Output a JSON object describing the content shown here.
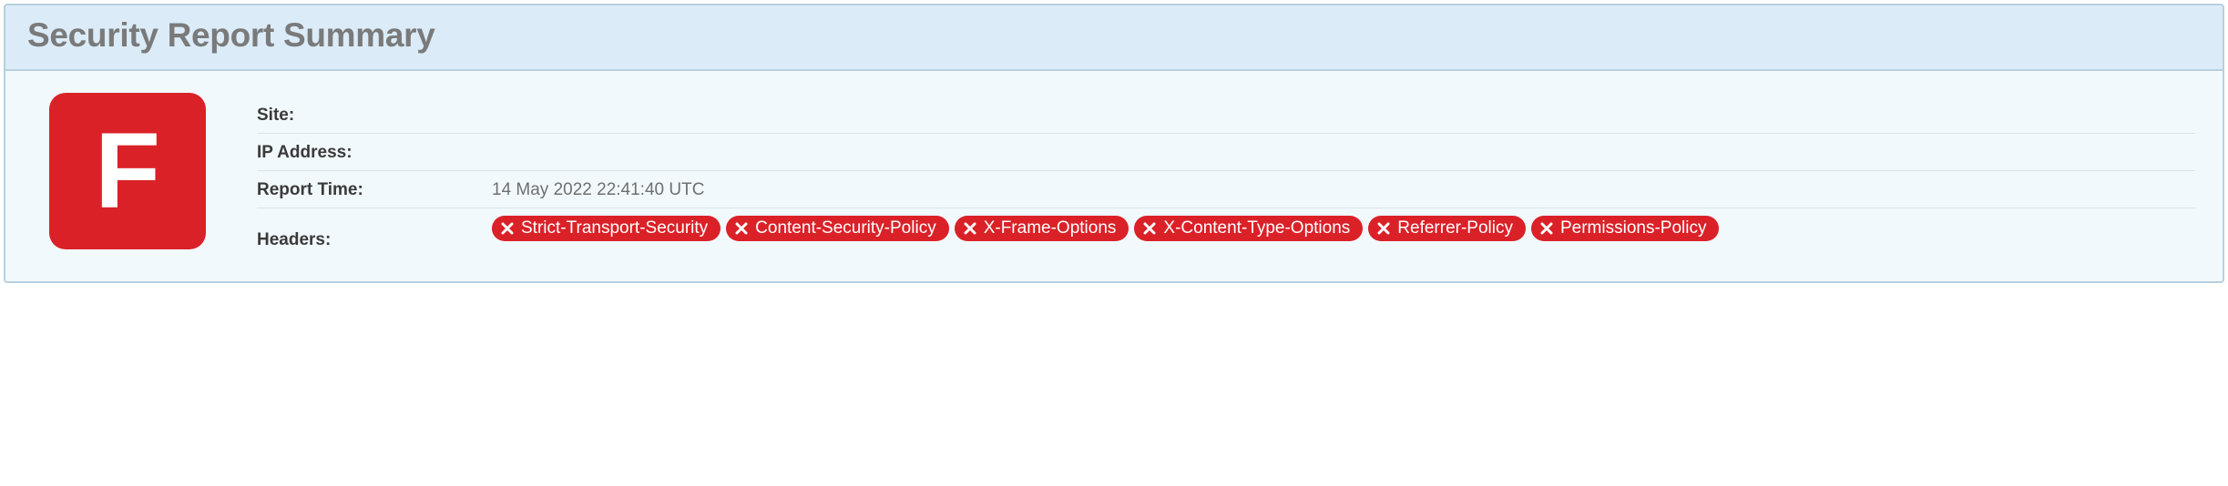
{
  "title": "Security Report Summary",
  "grade": "F",
  "rows": {
    "site_label": "Site:",
    "site_value": "",
    "ip_label": "IP Address:",
    "ip_value": "",
    "report_time_label": "Report Time:",
    "report_time_value": "14 May 2022 22:41:40 UTC",
    "headers_label": "Headers:"
  },
  "headers": [
    "Strict-Transport-Security",
    "Content-Security-Policy",
    "X-Frame-Options",
    "X-Content-Type-Options",
    "Referrer-Policy",
    "Permissions-Policy"
  ]
}
